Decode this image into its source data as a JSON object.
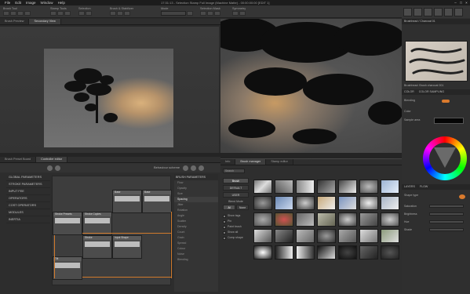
{
  "menu": [
    "File",
    "Edit",
    "Image",
    "Window",
    "Help"
  ],
  "window_title": "17:31:13 - Selection Stamp Full Image (Machine Matte) - 00:00:00:00 [EDIT 1]",
  "toolbar": {
    "groups": [
      "Brush Tool",
      "Stamp Tools",
      "Selection",
      "Brush & Stabilizer",
      "Mode",
      "Selection Mask",
      "Symmetry"
    ]
  },
  "tabs_top": [
    "Brush Preview",
    "Secondary View"
  ],
  "tabs_bottom": [
    "Brush Preset Board",
    "Controller editor"
  ],
  "tabs_bm": [
    "Info",
    "Brush manager",
    "Stamp editor"
  ],
  "controller": {
    "behaviour_label": "Behaviour scheme",
    "left_list": [
      "GLOBAL PARAMETERS",
      "STROKE PARAMETERS",
      "INPUT FEE",
      "OPERATORS",
      "COST OPERATORS",
      "MODULES",
      "INERTIA"
    ],
    "nodes": [
      "Base",
      "Base",
      "Stroke Presets",
      "Stroke Copies",
      "Stroke",
      "Input Shape",
      "Tilt"
    ],
    "params_header": "BRUSH PARAMETERS",
    "params": [
      "Flow",
      "Opacity",
      "Size",
      "Spacing",
      "Jitter",
      "Rotation",
      "Angle",
      "Scatter",
      "Density",
      "Count",
      "Grain",
      "Spread",
      "Colour",
      "Noise",
      "Blending"
    ],
    "params_selected": 3
  },
  "brush_manager": {
    "search": "Search",
    "buttons": [
      "Brush",
      "DEFAULT",
      "USER"
    ],
    "blend_label": "Blend Mode",
    "blend_opts": [
      "Al",
      "None"
    ],
    "checks": [
      "Show tags",
      "Pin",
      "Paint brush",
      "Show all",
      "Comp shape"
    ]
  },
  "right_panel": {
    "preset_name": "Brushhead / Charcoal 01",
    "brush_label": "Brushhead: Brush charcoal 001",
    "section_color": "COLOR",
    "section_color2": "COLOR SAMPLING",
    "blending_label": "Blending",
    "color_label": "Color",
    "sampling_label": "Sample area",
    "layers_tab": "LAYERS",
    "layers_tab2": "FLOW",
    "shape_type": "Shape type",
    "sliders": [
      "Saturation",
      "Brightness",
      "Hue",
      "Shade"
    ]
  },
  "colors": {
    "accent": "#d07a2c",
    "bg": "#2a2a2a"
  }
}
